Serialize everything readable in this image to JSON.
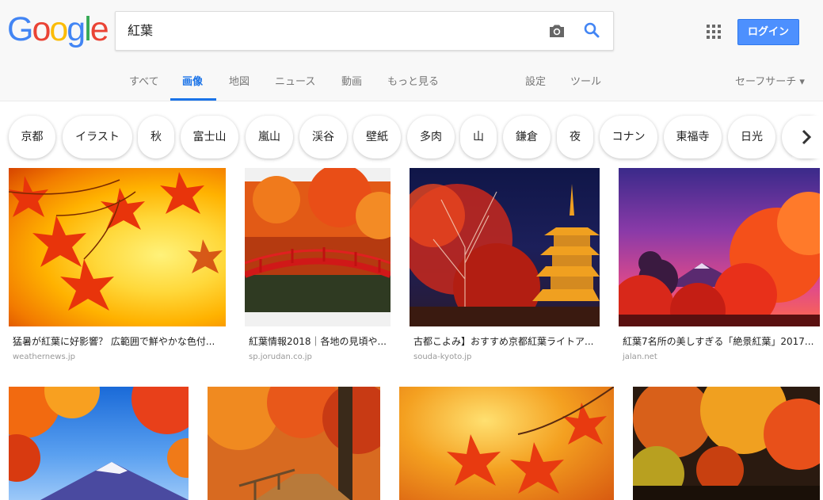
{
  "logo": {
    "letters": [
      "G",
      "o",
      "o",
      "g",
      "l",
      "e"
    ]
  },
  "search": {
    "query": "紅葉"
  },
  "header": {
    "login_label": "ログイン",
    "safe_search_label": "セーフサーチ ▾"
  },
  "tabs": [
    {
      "label": "すべて",
      "active": false
    },
    {
      "label": "画像",
      "active": true
    },
    {
      "label": "地図",
      "active": false
    },
    {
      "label": "ニュース",
      "active": false
    },
    {
      "label": "動画",
      "active": false
    },
    {
      "label": "もっと見る",
      "active": false
    },
    {
      "label": "設定",
      "active": false
    },
    {
      "label": "ツール",
      "active": false
    }
  ],
  "chips": [
    "京都",
    "イラスト",
    "秋",
    "富士山",
    "嵐山",
    "渓谷",
    "壁紙",
    "多肉",
    "山",
    "鎌倉",
    "夜",
    "コナン",
    "東福寺",
    "日光"
  ],
  "results": [
    {
      "title": "猛暑が紅葉に好影響？ 広範囲で鮮やかな色付...",
      "site": "weathernews.jp"
    },
    {
      "title": "紅葉情報2018｜各地の見頃や...",
      "site": "sp.jorudan.co.jp"
    },
    {
      "title": "古都こよみ】おすすめ京都紅葉ライトア...",
      "site": "souda-kyoto.jp"
    },
    {
      "title": "紅葉7名所の美しすぎる「絶景紅葉」2017...",
      "site": "jalan.net"
    }
  ],
  "colors": {
    "accent": "#1a73e8",
    "login_bg": "#4d90fe"
  }
}
